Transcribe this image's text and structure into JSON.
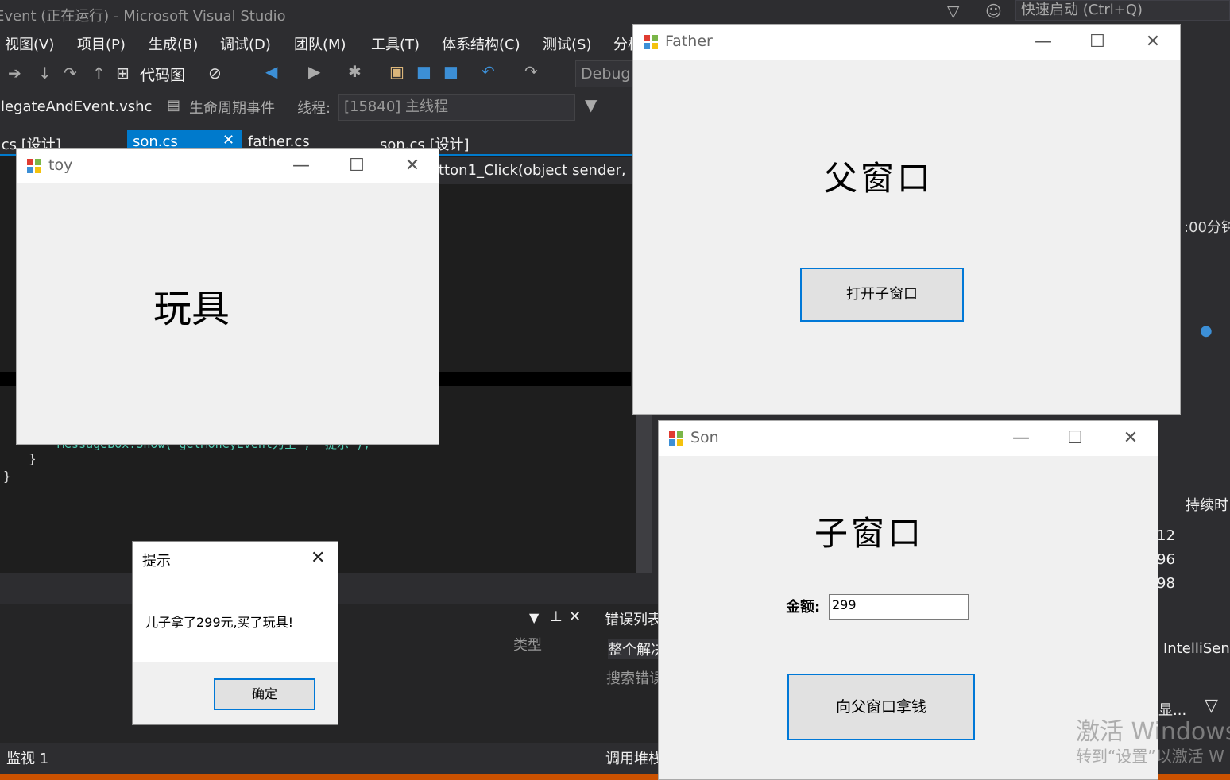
{
  "vs": {
    "title": "Event (正在运行) - Microsoft Visual Studio",
    "quick_launch": "快速启动 (Ctrl+Q)",
    "menu": [
      "视图(V)",
      "项目(P)",
      "生成(B)",
      "调试(D)",
      "团队(M)",
      "工具(T)",
      "体系结构(C)",
      "测试(S)",
      "分析"
    ],
    "toolbar": {
      "code_map": "代码图",
      "config": "Debug"
    },
    "toolbar2": {
      "project": "legateAndEvent.vshc",
      "lifecycle": "生命周期事件",
      "thread_label": "线程:",
      "thread": "[15840] 主线程"
    },
    "tabs": [
      ".cs [设计]",
      "son.cs",
      "father.cs",
      "son.cs [设计]"
    ],
    "method": "tton1_Click(object sender, Ev",
    "code_snippet": "MessageBox.Show(\"getMoneyEvent为空\", \"提示\");",
    "bottom": {
      "type_col": "类型",
      "error_list": "错误列表",
      "whole_solution": "整个解决",
      "search_errors": "搜索错误",
      "watch": "监视 1",
      "call_stack": "调用堆栈"
    },
    "right_panel": {
      "time": ":00分钟",
      "duration": "持续时",
      "num1": "12",
      "num2": "96",
      "num3": "98",
      "intellisense": "IntelliSens",
      "show": "显..."
    },
    "activate": {
      "line1": "激活 Windows",
      "line2": "转到“设置”以激活 W"
    }
  },
  "toy_window": {
    "title": "toy",
    "label": "玩具"
  },
  "father_window": {
    "title": "Father",
    "heading": "父窗口",
    "open_button": "打开子窗口"
  },
  "son_window": {
    "title": "Son",
    "heading": "子窗口",
    "amount_label": "金额:",
    "amount_value": "299",
    "get_money_button": "向父窗口拿钱"
  },
  "message_box": {
    "title": "提示",
    "message": "儿子拿了299元,买了玩具!",
    "ok_button": "确定"
  },
  "colors": {
    "accent": "#0078d7",
    "vs_blue": "#007acc",
    "vs_bg": "#2d2d30",
    "editor_bg": "#1e1e1e",
    "window_bg": "#f0f0f0"
  }
}
